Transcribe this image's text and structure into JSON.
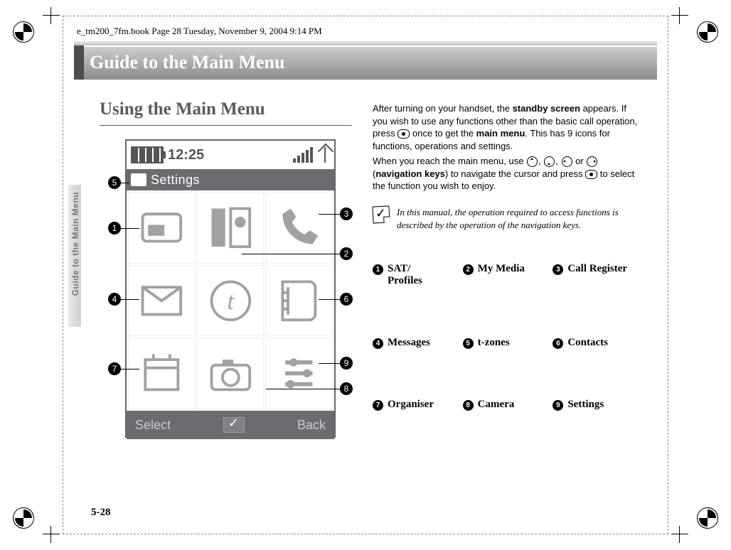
{
  "book_header": "e_tm200_7fm.book  Page 28  Tuesday, November 9, 2004  9:14 PM",
  "chapter_title": "Guide to the Main Menu",
  "side_tab_label": "Guide to the Main Menu",
  "section_heading": "Using the Main Menu",
  "page_number": "5-28",
  "phone": {
    "time": "12:25",
    "titlebar": "Settings",
    "softkey_left": "Select",
    "softkey_right": "Back"
  },
  "paragraph1": {
    "pre": "After turning on your handset, the ",
    "bold1": "standby screen",
    "mid1": " appears. If you wish to use any functions other than the basic call operation, press ",
    "mid2": " once to get the ",
    "bold2": "main menu",
    "post": ". This has 9 icons for functions, operations and settings."
  },
  "paragraph2": {
    "pre": "When you reach the main menu, use ",
    "sep": ", ",
    "or": " or ",
    "mid": " (",
    "bold": "navigation keys",
    "mid2": ") to navigate the cursor and press ",
    "post": " to select the function you wish to enjoy."
  },
  "note_text": "In this manual, the operation required to access functions is described by the operation of the navigation keys.",
  "callouts": {
    "1": "1",
    "2": "2",
    "3": "3",
    "4": "4",
    "5": "5",
    "6": "6",
    "7": "7",
    "8": "8",
    "9": "9"
  },
  "legend": [
    {
      "n": "1",
      "label": "SAT/\nProfiles"
    },
    {
      "n": "2",
      "label": "My Media"
    },
    {
      "n": "3",
      "label": "Call Register"
    },
    {
      "n": "4",
      "label": "Messages"
    },
    {
      "n": "5",
      "label": "t-zones"
    },
    {
      "n": "6",
      "label": "Contacts"
    },
    {
      "n": "7",
      "label": "Organiser"
    },
    {
      "n": "8",
      "label": "Camera"
    },
    {
      "n": "9",
      "label": "Settings"
    }
  ]
}
